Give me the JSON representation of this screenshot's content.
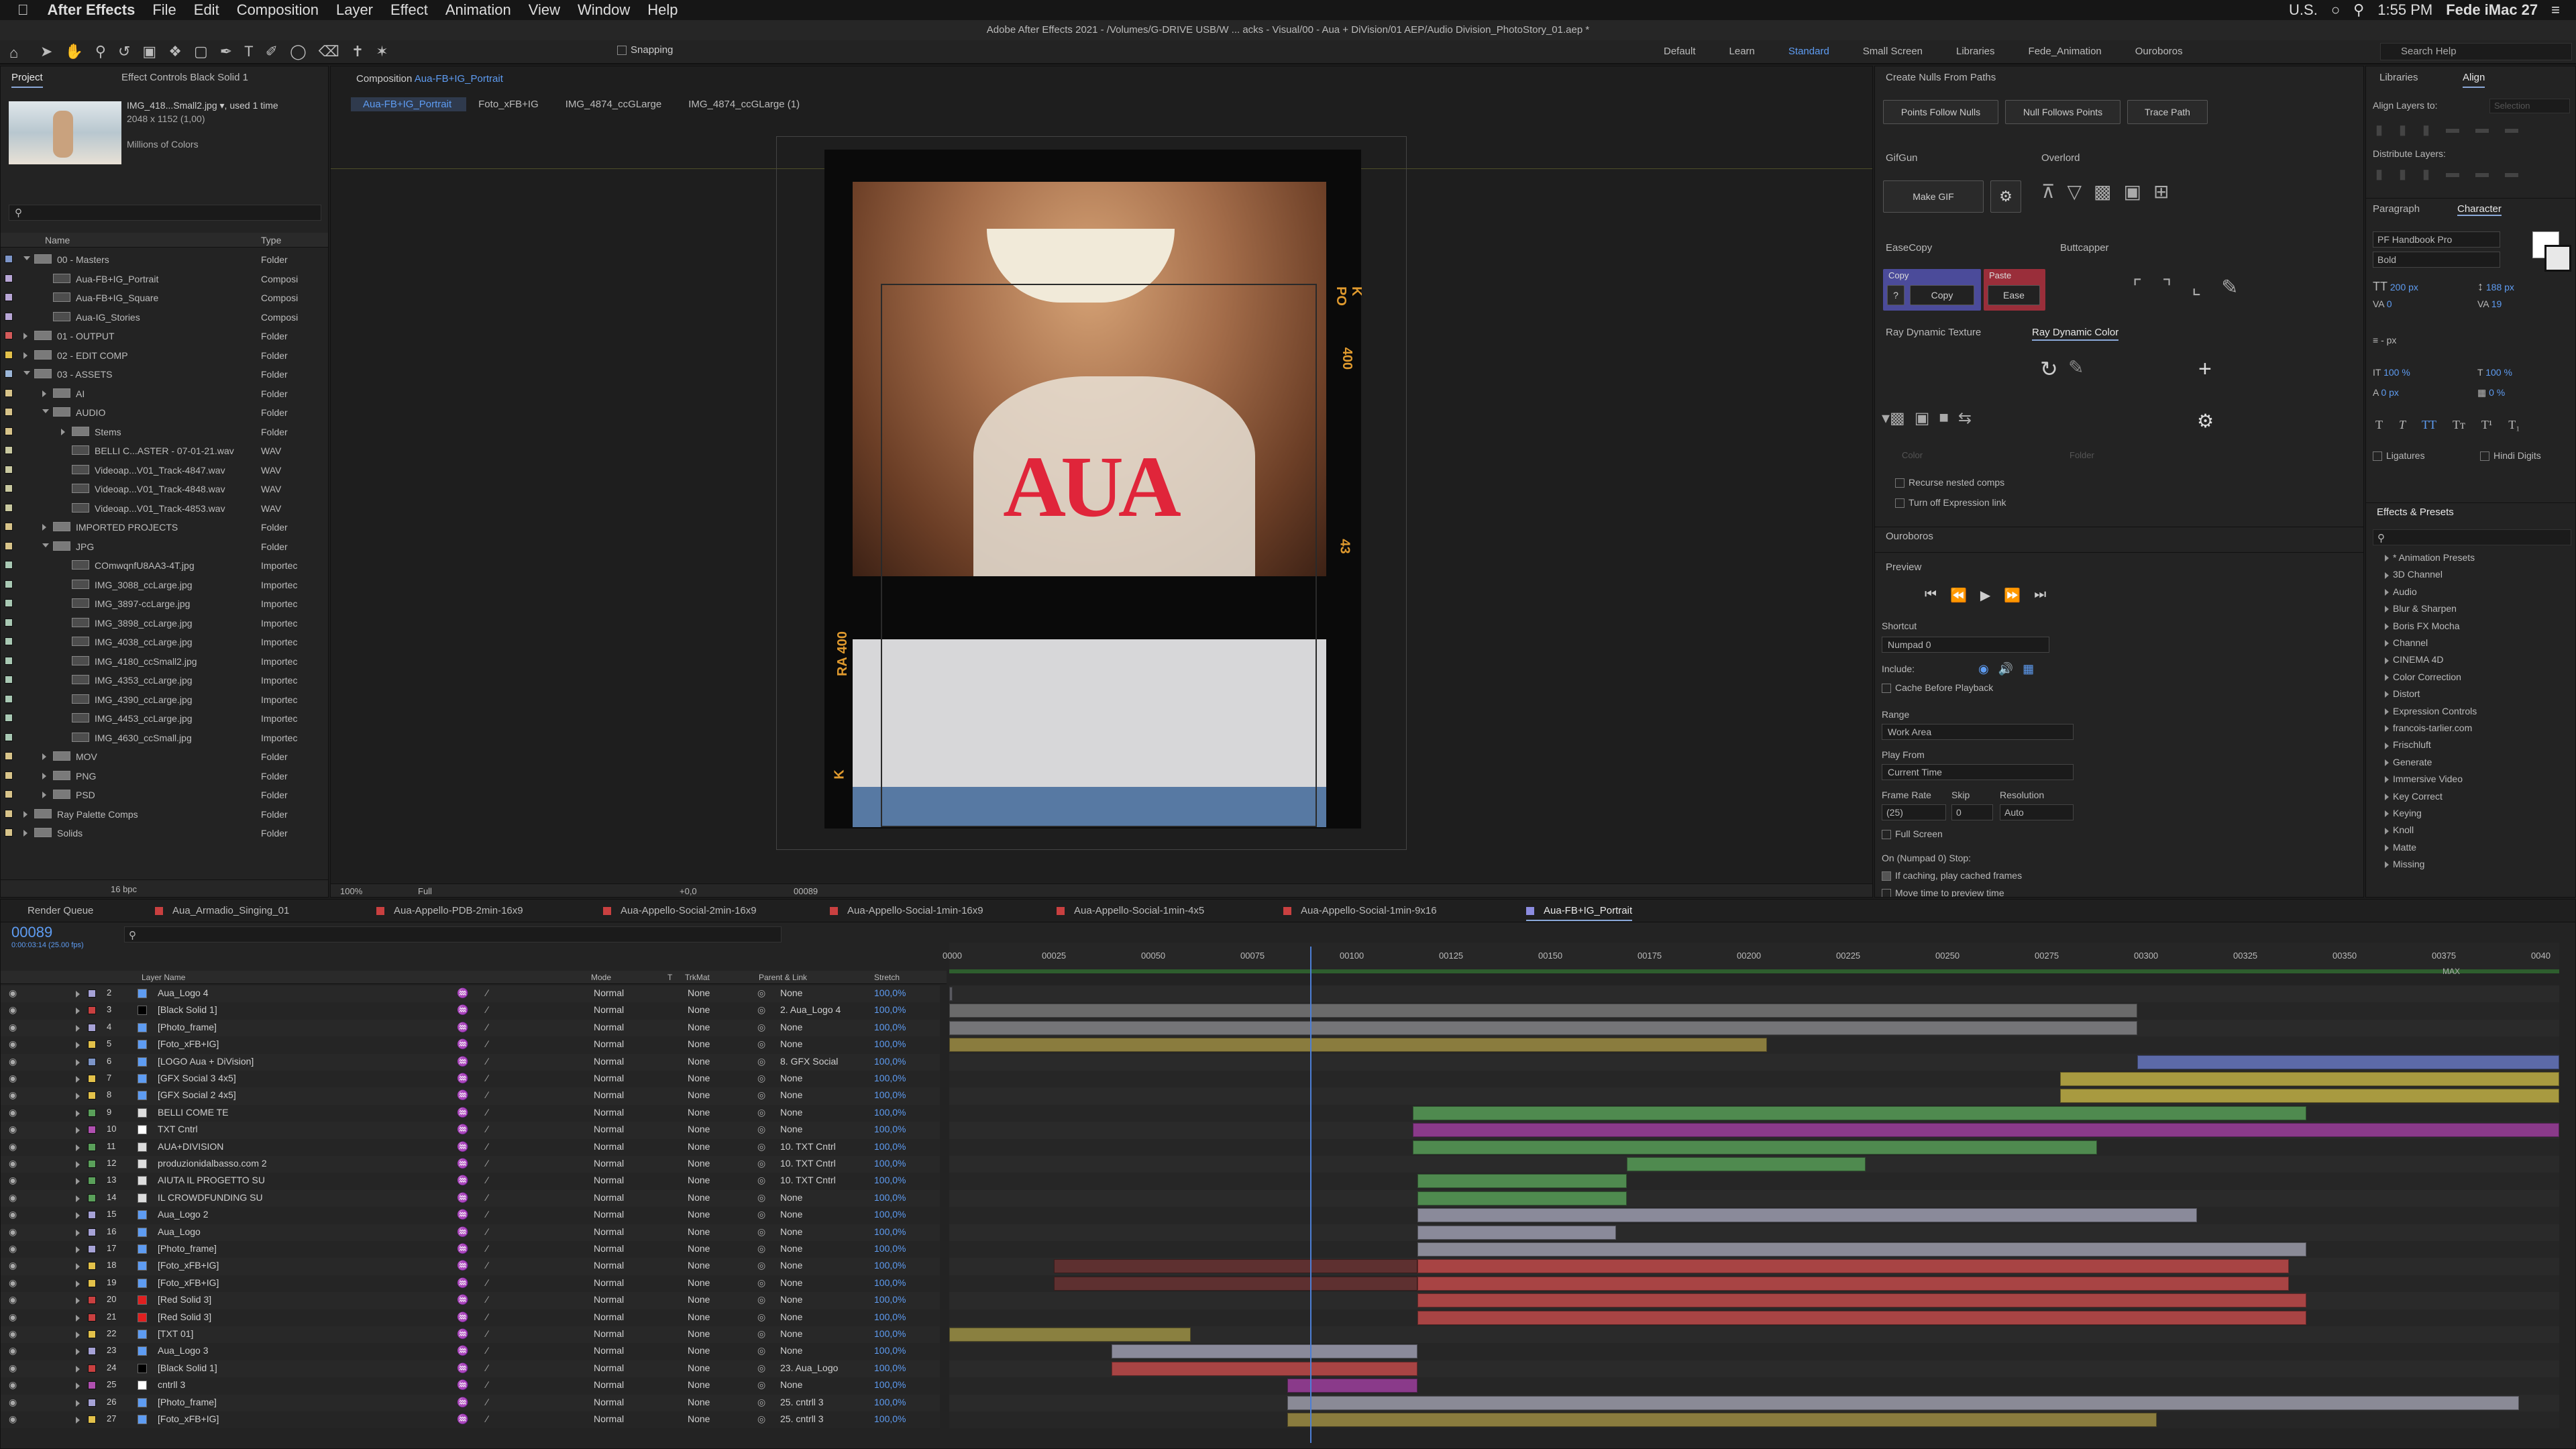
{
  "menubar": {
    "app": "After Effects",
    "items": [
      "File",
      "Edit",
      "Composition",
      "Layer",
      "Effect",
      "Animation",
      "View",
      "Window",
      "Help"
    ],
    "lang": "U.S.",
    "time": "1:55 PM",
    "user": "Fede iMac 27"
  },
  "title": "Adobe After Effects 2021 - /Volumes/G-DRIVE USB/W ... acks - Visual/00 - Aua + DiVision/01 AEP/Audio Division_PhotoStory_01.aep *",
  "toolbar": {
    "snapping": "Snapping",
    "workspaces": [
      "Default",
      "Learn",
      "Standard",
      "Small Screen",
      "Libraries",
      "Fede_Animation",
      "Ouroboros"
    ],
    "search": "Search Help"
  },
  "project": {
    "tab_project": "Project",
    "tab_effect": "Effect Controls Black Solid 1",
    "file": "IMG_418...Small2.jpg",
    "used": ", used 1 time",
    "dims": "2048 x 1152 (1,00)",
    "colors": "Millions of Colors",
    "col_name": "Name",
    "col_type": "Type",
    "bpc": "16 bpc",
    "items": [
      {
        "name": "00 - Masters",
        "type": "Folder",
        "c": "#7d95c8",
        "ind": 0,
        "folder": true,
        "open": true
      },
      {
        "name": "Aua-FB+IG_Portrait",
        "type": "Composi",
        "c": "#b8a6d6",
        "ind": 1
      },
      {
        "name": "Aua-FB+IG_Square",
        "type": "Composi",
        "c": "#b8a6d6",
        "ind": 1
      },
      {
        "name": "Aua-IG_Stories",
        "type": "Composi",
        "c": "#b8a6d6",
        "ind": 1
      },
      {
        "name": "01 - OUTPUT",
        "type": "Folder",
        "c": "#d35a5a",
        "ind": 0,
        "folder": true
      },
      {
        "name": "02 - EDIT COMP",
        "type": "Folder",
        "c": "#e3c14a",
        "ind": 0,
        "folder": true
      },
      {
        "name": "03 - ASSETS",
        "type": "Folder",
        "c": "#9bb6d8",
        "ind": 0,
        "folder": true,
        "open": true
      },
      {
        "name": "AI",
        "type": "Folder",
        "c": "#d8c48a",
        "ind": 1,
        "folder": true
      },
      {
        "name": "AUDIO",
        "type": "Folder",
        "c": "#d8c48a",
        "ind": 1,
        "folder": true,
        "open": true
      },
      {
        "name": "Stems",
        "type": "Folder",
        "c": "#d8c48a",
        "ind": 2,
        "folder": true
      },
      {
        "name": "BELLI C...ASTER - 07-01-21.wav",
        "type": "WAV",
        "c": "#c9c9a0",
        "ind": 2
      },
      {
        "name": "Videoap...V01_Track-4847.wav",
        "type": "WAV",
        "c": "#c9c9a0",
        "ind": 2
      },
      {
        "name": "Videoap...V01_Track-4848.wav",
        "type": "WAV",
        "c": "#c9c9a0",
        "ind": 2
      },
      {
        "name": "Videoap...V01_Track-4853.wav",
        "type": "WAV",
        "c": "#c9c9a0",
        "ind": 2
      },
      {
        "name": "IMPORTED PROJECTS",
        "type": "Folder",
        "c": "#d8c48a",
        "ind": 1,
        "folder": true
      },
      {
        "name": "JPG",
        "type": "Folder",
        "c": "#d8c48a",
        "ind": 1,
        "folder": true,
        "open": true
      },
      {
        "name": "COmwqnfU8AA3-4T.jpg",
        "type": "Importec",
        "c": "#a9c9b4",
        "ind": 2
      },
      {
        "name": "IMG_3088_ccLarge.jpg",
        "type": "Importec",
        "c": "#a9c9b4",
        "ind": 2
      },
      {
        "name": "IMG_3897-ccLarge.jpg",
        "type": "Importec",
        "c": "#a9c9b4",
        "ind": 2
      },
      {
        "name": "IMG_3898_ccLarge.jpg",
        "type": "Importec",
        "c": "#a9c9b4",
        "ind": 2
      },
      {
        "name": "IMG_4038_ccLarge.jpg",
        "type": "Importec",
        "c": "#a9c9b4",
        "ind": 2
      },
      {
        "name": "IMG_4180_ccSmall2.jpg",
        "type": "Importec",
        "c": "#a9c9b4",
        "ind": 2
      },
      {
        "name": "IMG_4353_ccLarge.jpg",
        "type": "Importec",
        "c": "#a9c9b4",
        "ind": 2
      },
      {
        "name": "IMG_4390_ccLarge.jpg",
        "type": "Importec",
        "c": "#a9c9b4",
        "ind": 2
      },
      {
        "name": "IMG_4453_ccLarge.jpg",
        "type": "Importec",
        "c": "#a9c9b4",
        "ind": 2
      },
      {
        "name": "IMG_4630_ccSmall.jpg",
        "type": "Importec",
        "c": "#a9c9b4",
        "ind": 2
      },
      {
        "name": "MOV",
        "type": "Folder",
        "c": "#d8c48a",
        "ind": 1,
        "folder": true
      },
      {
        "name": "PNG",
        "type": "Folder",
        "c": "#d8c48a",
        "ind": 1,
        "folder": true
      },
      {
        "name": "PSD",
        "type": "Folder",
        "c": "#d8c48a",
        "ind": 1,
        "folder": true
      },
      {
        "name": "Ray Palette Comps",
        "type": "Folder",
        "c": "#d8c48a",
        "ind": 0,
        "folder": true
      },
      {
        "name": "Solids",
        "type": "Folder",
        "c": "#d8c48a",
        "ind": 0,
        "folder": true
      }
    ]
  },
  "comp": {
    "tab": "Composition",
    "name": "Aua-FB+IG_Portrait",
    "crumbs": [
      "Aua-FB+IG_Portrait",
      "Foto_xFB+IG",
      "IMG_4874_ccGLarge",
      "IMG_4874_ccGLarge (1)"
    ],
    "zoom": "100%",
    "res": "Full",
    "exposure": "+0,0",
    "tc": "00089",
    "logo": "AUA",
    "film_left": "RA 400",
    "film_right": "K PO",
    "film_num1": "400",
    "film_num2": "43",
    "film_k": "K"
  },
  "scripts": {
    "create_nulls": "Create Nulls From Paths",
    "b1": "Points Follow Nulls",
    "b2": "Null Follows Points",
    "b3": "Trace Path",
    "gifgun": "GifGun",
    "make_gif": "Make GIF",
    "overlord": "Overlord",
    "easecopy": "EaseCopy",
    "copy": "Copy",
    "paste": "Paste",
    "copy_btn": "Copy",
    "ease_btn": "Ease",
    "q": "?",
    "buttcapper": "Buttcapper",
    "rdt": "Ray Dynamic Texture",
    "rdc": "Ray Dynamic Color",
    "color": "Color",
    "folder": "Folder",
    "recurse": "Recurse nested comps",
    "turnoff": "Turn off Expression link",
    "ouroboros": "Ouroboros"
  },
  "preview": {
    "title": "Preview",
    "shortcut_l": "Shortcut",
    "shortcut": "Numpad 0",
    "include": "Include:",
    "cache": "Cache Before Playback",
    "range_l": "Range",
    "range": "Work Area",
    "playfrom_l": "Play From",
    "playfrom": "Current Time",
    "fr_l": "Frame Rate",
    "skip_l": "Skip",
    "res_l": "Resolution",
    "fr": "(25)",
    "skip": "0",
    "res": "Auto",
    "fullscreen": "Full Screen",
    "stop": "On (Numpad 0) Stop:",
    "ifcache": "If caching, play cached frames",
    "move": "Move time to preview time"
  },
  "align": {
    "libraries": "Libraries",
    "align": "Align",
    "align_to": "Align Layers to:",
    "selection": "Selection",
    "distribute": "Distribute Layers:"
  },
  "character": {
    "paragraph": "Paragraph",
    "character": "Character",
    "font": "PF Handbook Pro",
    "style": "Bold",
    "size": "200 px",
    "lead": "188 px",
    "kern": "0",
    "track": "19",
    "stroke": "- px",
    "vscale": "100 %",
    "hscale": "100 %",
    "baseline": "0 px",
    "tsume": "0 %",
    "ligatures": "Ligatures",
    "hindi": "Hindi Digits"
  },
  "effects": {
    "title": "Effects & Presets",
    "items": [
      "* Animation Presets",
      "3D Channel",
      "Audio",
      "Blur & Sharpen",
      "Boris FX Mocha",
      "Channel",
      "CINEMA 4D",
      "Color Correction",
      "Distort",
      "Expression Controls",
      "francois-tarlier.com",
      "Frischluft",
      "Generate",
      "Immersive Video",
      "Key Correct",
      "Keying",
      "Knoll",
      "Matte",
      "Missing"
    ]
  },
  "timeline": {
    "render_queue": "Render Queue",
    "tabs": [
      {
        "n": "Aua_Armadio_Singing_01",
        "c": "#c94040"
      },
      {
        "n": "Aua-Appello-PDB-2min-16x9",
        "c": "#c94040"
      },
      {
        "n": "Aua-Appello-Social-2min-16x9",
        "c": "#c94040"
      },
      {
        "n": "Aua-Appello-Social-1min-16x9",
        "c": "#c94040"
      },
      {
        "n": "Aua-Appello-Social-1min-4x5",
        "c": "#c94040"
      },
      {
        "n": "Aua-Appello-Social-1min-9x16",
        "c": "#c94040"
      },
      {
        "n": "Aua-FB+IG_Portrait",
        "c": "#8c8ce0"
      }
    ],
    "tc": "00089",
    "tc_sub": "0:00:03:14 (25.00 fps)",
    "cols": {
      "layer": "Layer Name",
      "mode": "Mode",
      "t": "T",
      "trk": "TrkMat",
      "parent": "Parent & Link",
      "stretch": "Stretch"
    },
    "max": "MAX",
    "ruler": [
      "0000",
      "00025",
      "00050",
      "00075",
      "00100",
      "00125",
      "00150",
      "00175",
      "00200",
      "00225",
      "00250",
      "00275",
      "00300",
      "00325",
      "00350",
      "00375",
      "0040"
    ],
    "layers": [
      {
        "n": "2",
        "name": "Aua_Logo 4",
        "c": "#a6a2d6",
        "t": "comp",
        "mode": "Normal",
        "trk": "None",
        "parent": "None",
        "s": "100,0%",
        "b": [
          [
            0,
            0.2,
            "#5a5a60"
          ]
        ]
      },
      {
        "n": "3",
        "name": "[Black Solid 1]",
        "c": "#c94040",
        "t": "black",
        "mode": "Normal",
        "trk": "None",
        "parent": "2. Aua_Logo 4",
        "s": "100,0%",
        "b": [
          [
            0,
            73.8,
            "#6a6a6a"
          ]
        ]
      },
      {
        "n": "4",
        "name": "[Photo_frame]",
        "c": "#a6a2d6",
        "t": "comp",
        "mode": "Normal",
        "trk": "None",
        "parent": "None",
        "s": "100,0%",
        "b": [
          [
            0,
            73.8,
            "#757578"
          ]
        ]
      },
      {
        "n": "5",
        "name": "[Foto_xFB+IG]",
        "c": "#e3c14a",
        "t": "comp",
        "mode": "Normal",
        "trk": "None",
        "parent": "None",
        "s": "100,0%",
        "b": [
          [
            0,
            50.8,
            "#8a7c3e"
          ]
        ]
      },
      {
        "n": "6",
        "name": "[LOGO Aua + DiVision]",
        "c": "#7d95c8",
        "t": "comp",
        "mode": "Normal",
        "trk": "None",
        "parent": "8. GFX Social",
        "s": "100,0%",
        "b": [
          [
            73.8,
            100,
            "#5c6aa8"
          ]
        ]
      },
      {
        "n": "7",
        "name": "[GFX Social 3 4x5]",
        "c": "#e3c14a",
        "t": "comp",
        "mode": "Normal",
        "trk": "None",
        "parent": "None",
        "s": "100,0%",
        "b": [
          [
            69,
            100,
            "#a89a40"
          ]
        ]
      },
      {
        "n": "8",
        "name": "[GFX Social 2 4x5]",
        "c": "#e3c14a",
        "t": "comp",
        "mode": "Normal",
        "trk": "None",
        "parent": "None",
        "s": "100,0%",
        "b": [
          [
            69,
            100,
            "#a89a40"
          ]
        ]
      },
      {
        "n": "9",
        "name": "BELLI COME TE",
        "c": "#5aa05a",
        "t": "text",
        "mode": "Normal",
        "trk": "None",
        "parent": "None",
        "s": "100,0%",
        "b": [
          [
            28.8,
            84.3,
            "#4f8a4f"
          ]
        ]
      },
      {
        "n": "10",
        "name": "TXT Cntrl",
        "c": "#b050b0",
        "t": "white",
        "mode": "Normal",
        "trk": "None",
        "parent": "None",
        "s": "100,0%",
        "b": [
          [
            28.8,
            100,
            "#8a3a8a"
          ]
        ]
      },
      {
        "n": "11",
        "name": "AUA+DIVISION",
        "c": "#5aa05a",
        "t": "text",
        "mode": "Normal",
        "trk": "None",
        "parent": "10. TXT Cntrl",
        "s": "100,0%",
        "b": [
          [
            28.8,
            71.3,
            "#4f8a4f"
          ]
        ]
      },
      {
        "n": "12",
        "name": "produzionidalbasso.com 2",
        "c": "#5aa05a",
        "t": "text",
        "mode": "Normal",
        "trk": "None",
        "parent": "10. TXT Cntrl",
        "s": "100,0%",
        "b": [
          [
            42.1,
            56.9,
            "#4f8a4f"
          ]
        ]
      },
      {
        "n": "13",
        "name": "AIUTA IL PROGETTO SU",
        "c": "#5aa05a",
        "t": "text",
        "mode": "Normal",
        "trk": "None",
        "parent": "10. TXT Cntrl",
        "s": "100,0%",
        "b": [
          [
            29.1,
            42.1,
            "#4f8a4f"
          ]
        ]
      },
      {
        "n": "14",
        "name": "IL CROWDFUNDING SU",
        "c": "#5aa05a",
        "t": "text",
        "mode": "Normal",
        "trk": "None",
        "parent": "None",
        "s": "100,0%",
        "b": [
          [
            29.1,
            42.1,
            "#4f8a4f"
          ]
        ]
      },
      {
        "n": "15",
        "name": "Aua_Logo 2",
        "c": "#a6a2d6",
        "t": "comp",
        "mode": "Normal",
        "trk": "None",
        "parent": "None",
        "s": "100,0%",
        "b": [
          [
            29.1,
            77.5,
            "#8a8a9a"
          ]
        ]
      },
      {
        "n": "16",
        "name": "Aua_Logo",
        "c": "#a6a2d6",
        "t": "comp",
        "mode": "Normal",
        "trk": "None",
        "parent": "None",
        "s": "100,0%",
        "b": [
          [
            29.1,
            41.4,
            "#8a8a9a"
          ]
        ]
      },
      {
        "n": "17",
        "name": "[Photo_frame]",
        "c": "#a6a2d6",
        "t": "comp",
        "mode": "Normal",
        "trk": "None",
        "parent": "None",
        "s": "100,0%",
        "b": [
          [
            29.1,
            84.3,
            "#8a8a96"
          ]
        ]
      },
      {
        "n": "18",
        "name": "[Foto_xFB+IG]",
        "c": "#e3c14a",
        "t": "comp",
        "mode": "Normal",
        "trk": "None",
        "parent": "None",
        "s": "100,0%",
        "b": [
          [
            6.5,
            29.1,
            "#5e3030"
          ],
          [
            29.1,
            83.2,
            "#a84444"
          ]
        ]
      },
      {
        "n": "19",
        "name": "[Foto_xFB+IG]",
        "c": "#e3c14a",
        "t": "comp",
        "mode": "Normal",
        "trk": "None",
        "parent": "None",
        "s": "100,0%",
        "b": [
          [
            6.5,
            29.1,
            "#5e3030"
          ],
          [
            29.1,
            83.2,
            "#a84444"
          ]
        ]
      },
      {
        "n": "20",
        "name": "[Red Solid 3]",
        "c": "#c94040",
        "t": "red",
        "mode": "Normal",
        "trk": "None",
        "parent": "None",
        "s": "100,0%",
        "b": [
          [
            29.1,
            84.3,
            "#a84444"
          ]
        ]
      },
      {
        "n": "21",
        "name": "[Red Solid 3]",
        "c": "#c94040",
        "t": "red",
        "mode": "Normal",
        "trk": "None",
        "parent": "None",
        "s": "100,0%",
        "b": [
          [
            29.1,
            84.3,
            "#a84444"
          ]
        ]
      },
      {
        "n": "22",
        "name": "[TXT 01]",
        "c": "#e3c14a",
        "t": "comp",
        "mode": "Normal",
        "trk": "None",
        "parent": "None",
        "s": "100,0%",
        "b": [
          [
            0,
            15,
            "#8a8040"
          ]
        ]
      },
      {
        "n": "23",
        "name": "Aua_Logo 3",
        "c": "#a6a2d6",
        "t": "comp",
        "mode": "Normal",
        "trk": "None",
        "parent": "None",
        "s": "100,0%",
        "b": [
          [
            10.1,
            29.1,
            "#8a8a9a"
          ]
        ]
      },
      {
        "n": "24",
        "name": "[Black Solid 1]",
        "c": "#c94040",
        "t": "black",
        "mode": "Normal",
        "trk": "None",
        "parent": "23. Aua_Logo",
        "s": "100,0%",
        "b": [
          [
            10.1,
            29.1,
            "#a84444"
          ]
        ]
      },
      {
        "n": "25",
        "name": "cntrll 3",
        "c": "#b050b0",
        "t": "white",
        "mode": "Normal",
        "trk": "None",
        "parent": "None",
        "s": "100,0%",
        "b": [
          [
            21,
            29.1,
            "#8a3a8a"
          ]
        ]
      },
      {
        "n": "26",
        "name": "[Photo_frame]",
        "c": "#a6a2d6",
        "t": "comp",
        "mode": "Normal",
        "trk": "None",
        "parent": "25. cntrll 3",
        "s": "100,0%",
        "b": [
          [
            21,
            97.5,
            "#8a8a96"
          ]
        ]
      },
      {
        "n": "27",
        "name": "[Foto_xFB+IG]",
        "c": "#e3c14a",
        "t": "comp",
        "mode": "Normal",
        "trk": "None",
        "parent": "25. cntrll 3",
        "s": "100,0%",
        "b": [
          [
            21,
            75,
            "#8a7c3e"
          ]
        ]
      }
    ]
  }
}
